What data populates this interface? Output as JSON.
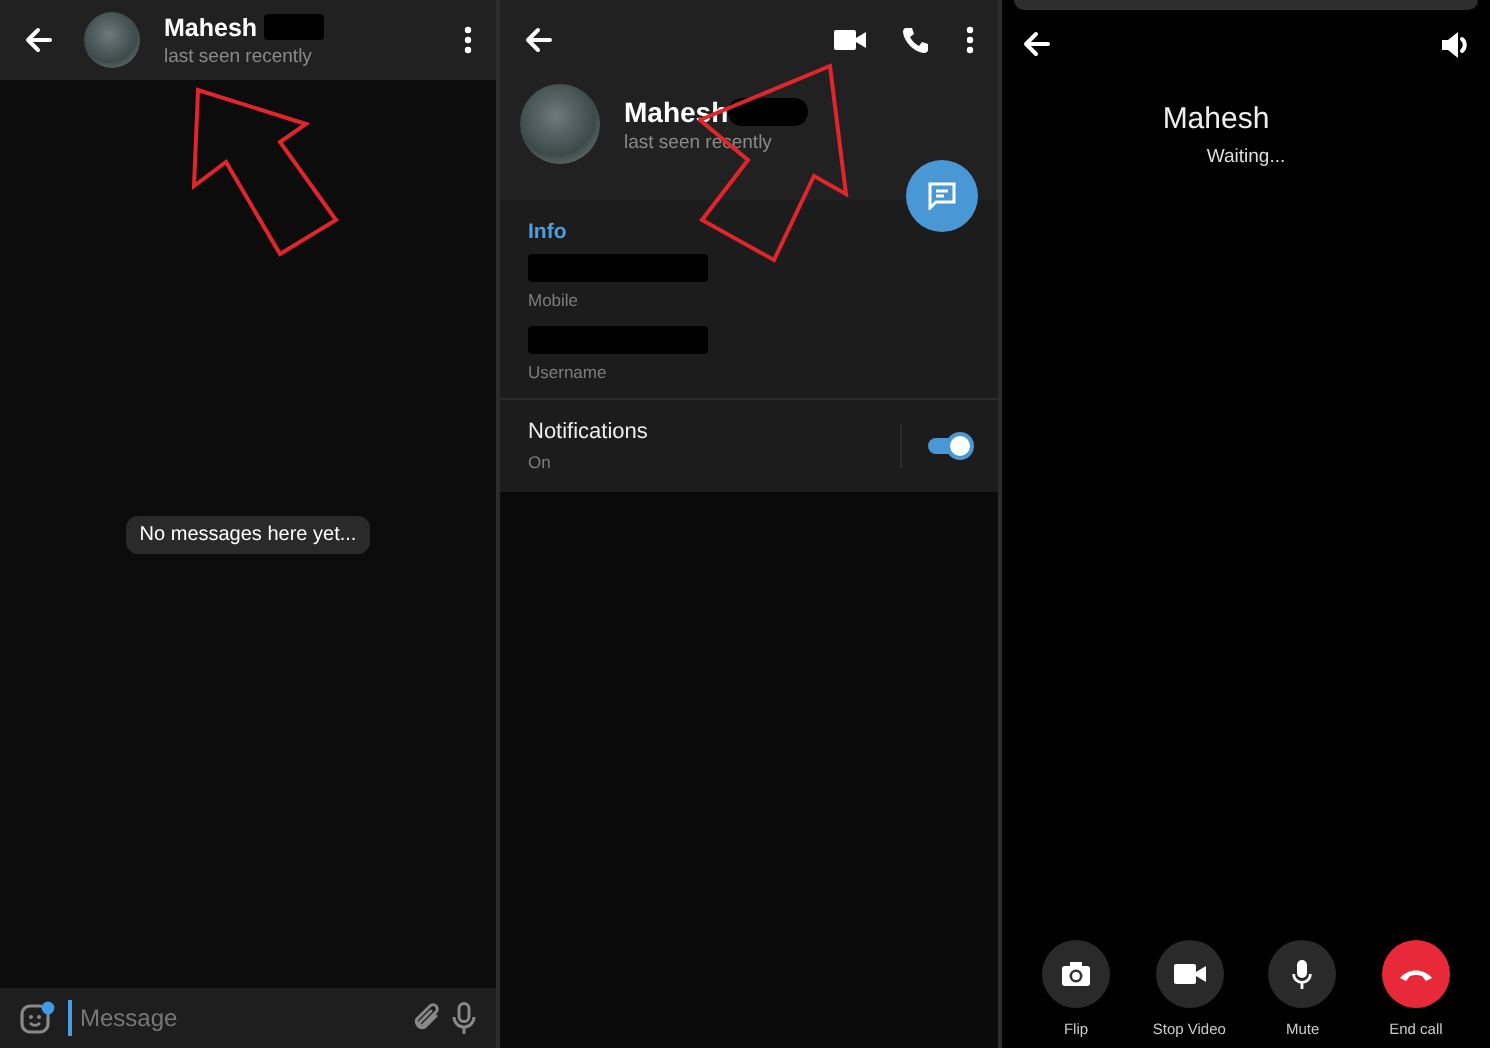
{
  "chat": {
    "title": "Mahesh",
    "subtitle": "last seen recently",
    "empty_notice": "No messages here yet...",
    "composer": {
      "placeholder": "Message"
    }
  },
  "profile": {
    "name": "Mahesh",
    "subtitle": "last seen recently",
    "section_title": "Info",
    "fields": [
      {
        "label": "Mobile"
      },
      {
        "label": "Username"
      }
    ],
    "notifications": {
      "label": "Notifications",
      "value": "On",
      "on": true
    }
  },
  "call": {
    "name": "Mahesh",
    "status": "Waiting...",
    "controls": [
      {
        "label": "Flip",
        "kind": "flip"
      },
      {
        "label": "Stop Video",
        "kind": "video"
      },
      {
        "label": "Mute",
        "kind": "mute"
      },
      {
        "label": "End call",
        "kind": "end"
      }
    ]
  }
}
